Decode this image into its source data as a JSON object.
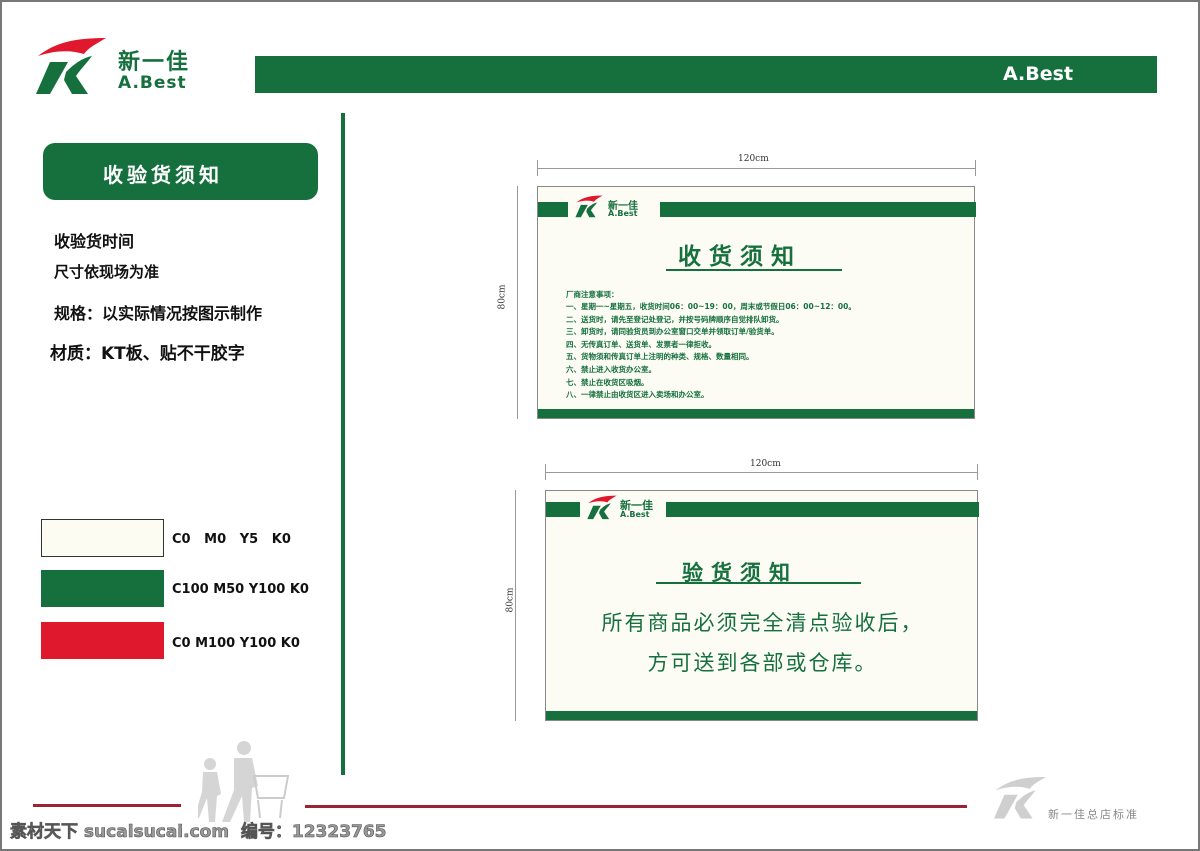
{
  "brand": {
    "name_cn": "新一佳",
    "name_en": "A.Best"
  },
  "header": {
    "banner_text": "A.Best"
  },
  "sidebar": {
    "title": "收验货须知",
    "specs": [
      "收验货时间",
      "尺寸依现场为准",
      "规格：以实际情况按图示制作",
      "材质：KT板、贴不干胶字"
    ],
    "swatches": [
      {
        "label": "C0   M0   Y5   K0",
        "color": "#fcfcf2"
      },
      {
        "label": "C100 M50 Y100 K0",
        "color": "#16703e"
      },
      {
        "label": "C0 M100 Y100 K0",
        "color": "#e0182d"
      }
    ]
  },
  "sign1": {
    "width_label": "120cm",
    "height_label": "80cm",
    "title": "收货须知",
    "notice_heading": "厂商注意事项：",
    "notices": [
      "一、星期一~星期五，收货时间06：00~19：00，周末或节假日06：00~12：00。",
      "二、送货时，请先至登记处登记，并按号码牌顺序自觉排队卸货。",
      "三、卸货时，请同验货员到办公室窗口交单并领取订单/验货单。",
      "四、无传真订单、送货单、发票者一律拒收。",
      "五、货物须和传真订单上注明的种类、规格、数量相同。",
      "六、禁止进入收货办公室。",
      "七、禁止在收货区吸烟。",
      "八、一律禁止由收货区进入卖场和办公室。"
    ]
  },
  "sign2": {
    "width_label": "120cm",
    "height_label": "80cm",
    "title": "验货须知",
    "lines": [
      "所有商品必须完全清点验收后，",
      "方可送到各部或仓库。"
    ]
  },
  "footer": {
    "standard_label": "新一佳总店标准",
    "watermark": "素材天下 sucaisucai.com  编号：12323765"
  },
  "colors": {
    "green": "#16703e",
    "red": "#e0182d",
    "maroon": "#9b2335"
  }
}
